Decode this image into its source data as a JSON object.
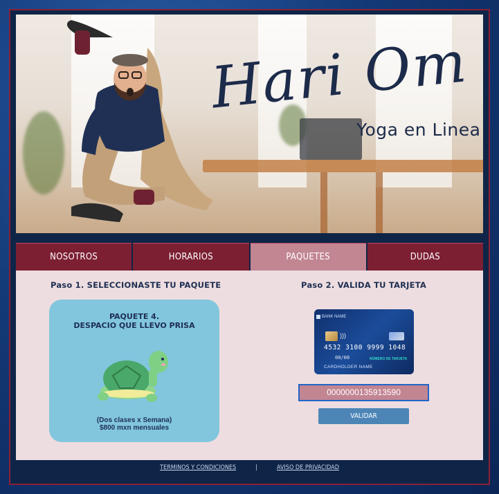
{
  "hero": {
    "brand_script": "Hari Om",
    "tagline": "Yoga en Linea"
  },
  "nav": {
    "tabs": [
      {
        "label": "NOSOTROS",
        "active": false
      },
      {
        "label": "HORARIOS",
        "active": false
      },
      {
        "label": "PAQUETES",
        "active": true
      },
      {
        "label": "DUDAS",
        "active": false
      }
    ]
  },
  "step1": {
    "title": "Paso 1. SELECCIONASTE TU PAQUETE",
    "package_title_line1": "PAQUETE 4.",
    "package_title_line2": "DESPACIO QUE LLEVO PRISA",
    "package_desc_line1": "(Dos clases x Semana)",
    "package_desc_line2": "$800 mxn mensuales"
  },
  "step2": {
    "title": "Paso 2. VALIDA TU TARJETA",
    "card": {
      "bank_name": "BANK NAME",
      "number": "4532 3100 9999 1048",
      "valid": "00/00",
      "number_label": "NÚMERO DE TARJETA",
      "holder": "CARDHOLDER NAME"
    },
    "card_input_value": "0000000135913590",
    "validate_label": "VALIDAR"
  },
  "footer": {
    "terms": "TERMINOS Y CONDICIONES",
    "separator": "|",
    "privacy": "AVISO DE PRIVACIDAD"
  },
  "colors": {
    "tab_bg": "#7d1f33",
    "tab_active_bg": "#c28592",
    "content_bg": "#eedde0",
    "package_card_bg": "#81c6dd",
    "button_bg": "#4d86b6"
  }
}
